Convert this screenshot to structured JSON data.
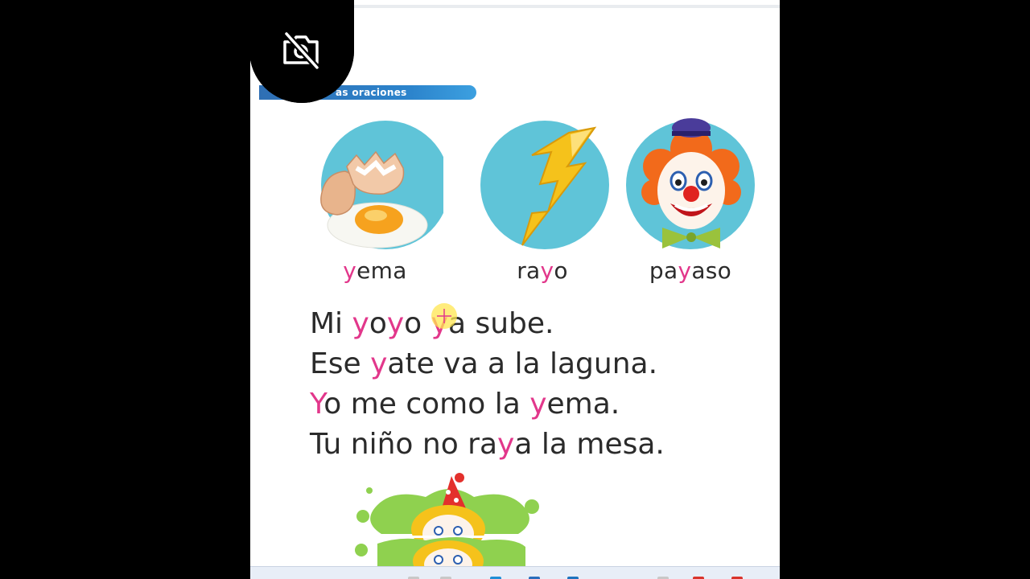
{
  "section": {
    "title": "as oraciones"
  },
  "words": [
    {
      "pre": "",
      "y": "y",
      "post": "ema",
      "image": "egg-yolk-icon"
    },
    {
      "pre": "ra",
      "y": "y",
      "post": "o",
      "image": "lightning-bolt-icon"
    },
    {
      "pre": "pa",
      "y": "y",
      "post": "aso",
      "image": "clown-icon"
    }
  ],
  "sentences": {
    "s1": {
      "a": "Mi ",
      "b": "y",
      "c": "o",
      "d": "y",
      "e": "o ",
      "f": "y",
      "g": "a sube."
    },
    "s2": {
      "a": "Ese ",
      "b": "y",
      "c": "ate va a la laguna."
    },
    "s3": {
      "a": "Y",
      "b": "o me como la ",
      "c": "y",
      "d": "ema."
    },
    "s4": {
      "a": "Tu niño no ra",
      "b": "y",
      "c": "a la mesa."
    }
  },
  "colors": {
    "highlight_letter": "#e2378b",
    "text": "#2b2b2b",
    "circle_bg": "#5fc4d8",
    "section_bar": "#2c84cc"
  },
  "overlay": {
    "camera_button_icon": "camera-off-icon"
  }
}
